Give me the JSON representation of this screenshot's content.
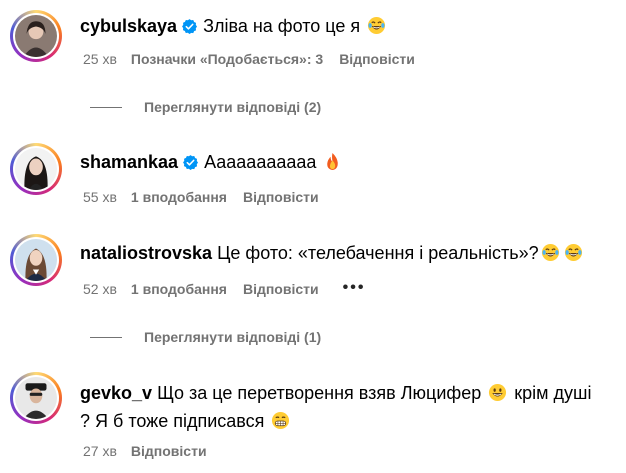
{
  "comments": [
    {
      "username": "cybulskaya",
      "verified": true,
      "text": "Зліва на фото це я",
      "emojis": [
        "laughing-crying"
      ],
      "time": "25 хв",
      "likes": "Позначки «Подобається»: 3",
      "reply": "Відповісти",
      "view_replies": "Переглянути відповіді (2)"
    },
    {
      "username": "shamankaa",
      "verified": true,
      "text": "Ааааааааааа",
      "emojis": [
        "fire"
      ],
      "time": "55 хв",
      "likes": "1 вподобання",
      "reply": "Відповісти"
    },
    {
      "username": "nataliostrovska",
      "verified": false,
      "text": "Це фото: «телебачення і реальність»?",
      "emojis": [
        "laughing-crying",
        "laughing-crying"
      ],
      "time": "52 хв",
      "likes": "1 вподобання",
      "reply": "Відповісти",
      "more": "•••",
      "view_replies": "Переглянути відповіді (1)"
    },
    {
      "username": "gevko_v",
      "verified": false,
      "text_part1": "Що за це перетворення взяв Люцифер",
      "text_part2": "крім душі ? Я б тоже підписався",
      "emojis": [
        "grinning",
        "grimacing"
      ],
      "time": "27 хв",
      "reply": "Відповісти"
    }
  ],
  "colors": {
    "secondary_text": "#737373",
    "verified_blue": "#0095f6",
    "primary_text": "#000000"
  }
}
